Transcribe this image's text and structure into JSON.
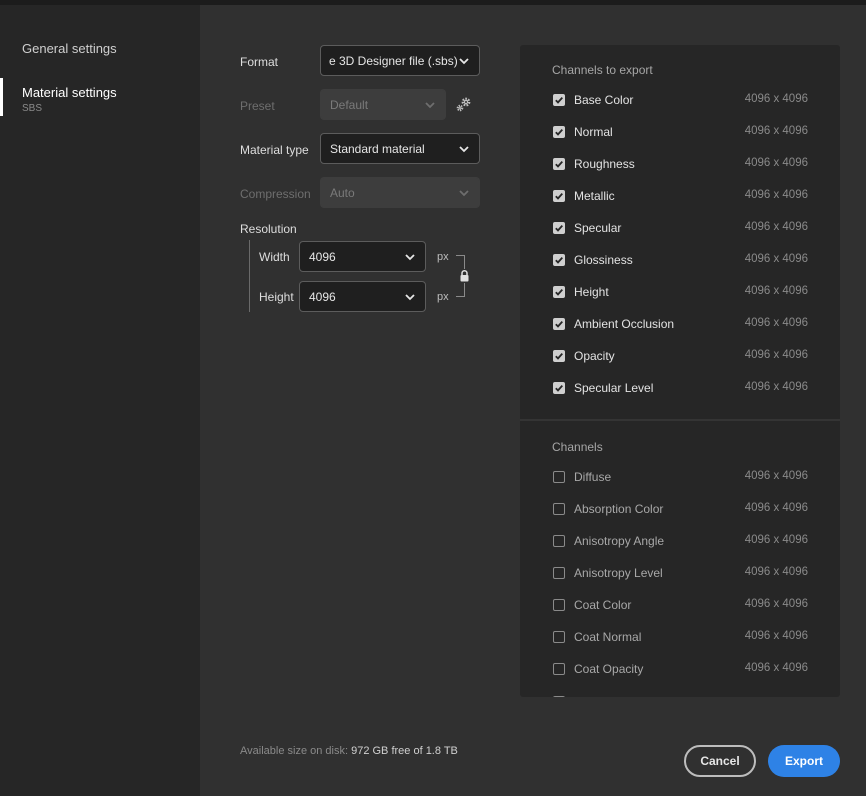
{
  "sidebar": {
    "general_label": "General settings",
    "material_label": "Material settings",
    "material_sub": "SBS"
  },
  "form": {
    "format_label": "Format",
    "format_value": "e 3D Designer file (.sbs)",
    "preset_label": "Preset",
    "preset_value": "Default",
    "material_type_label": "Material type",
    "material_type_value": "Standard material",
    "compression_label": "Compression",
    "compression_value": "Auto",
    "resolution_label": "Resolution",
    "width_label": "Width",
    "width_value": "4096",
    "height_label": "Height",
    "height_value": "4096",
    "unit": "px"
  },
  "export_channels": {
    "title": "Channels to export",
    "items": [
      {
        "name": "Base Color",
        "size": "4096 x 4096",
        "checked": true
      },
      {
        "name": "Normal",
        "size": "4096 x 4096",
        "checked": true
      },
      {
        "name": "Roughness",
        "size": "4096 x 4096",
        "checked": true
      },
      {
        "name": "Metallic",
        "size": "4096 x 4096",
        "checked": true
      },
      {
        "name": "Specular",
        "size": "4096 x 4096",
        "checked": true
      },
      {
        "name": "Glossiness",
        "size": "4096 x 4096",
        "checked": true
      },
      {
        "name": "Height",
        "size": "4096 x 4096",
        "checked": true
      },
      {
        "name": "Ambient Occlusion",
        "size": "4096 x 4096",
        "checked": true
      },
      {
        "name": "Opacity",
        "size": "4096 x 4096",
        "checked": true
      },
      {
        "name": "Specular Level",
        "size": "4096 x 4096",
        "checked": true
      }
    ]
  },
  "other_channels": {
    "title": "Channels",
    "items": [
      {
        "name": "Diffuse",
        "size": "4096 x 4096",
        "checked": false
      },
      {
        "name": "Absorption Color",
        "size": "4096 x 4096",
        "checked": false
      },
      {
        "name": "Anisotropy Angle",
        "size": "4096 x 4096",
        "checked": false
      },
      {
        "name": "Anisotropy Level",
        "size": "4096 x 4096",
        "checked": false
      },
      {
        "name": "Coat Color",
        "size": "4096 x 4096",
        "checked": false
      },
      {
        "name": "Coat Normal",
        "size": "4096 x 4096",
        "checked": false
      },
      {
        "name": "Coat Opacity",
        "size": "4096 x 4096",
        "checked": false
      }
    ]
  },
  "footer": {
    "disk_label": "Available size on disk:",
    "disk_value": "972 GB free of 1.8 TB",
    "cancel_label": "Cancel",
    "export_label": "Export"
  },
  "colors": {
    "accent": "#2e82e6",
    "panel": "#262626",
    "background": "#303030"
  }
}
